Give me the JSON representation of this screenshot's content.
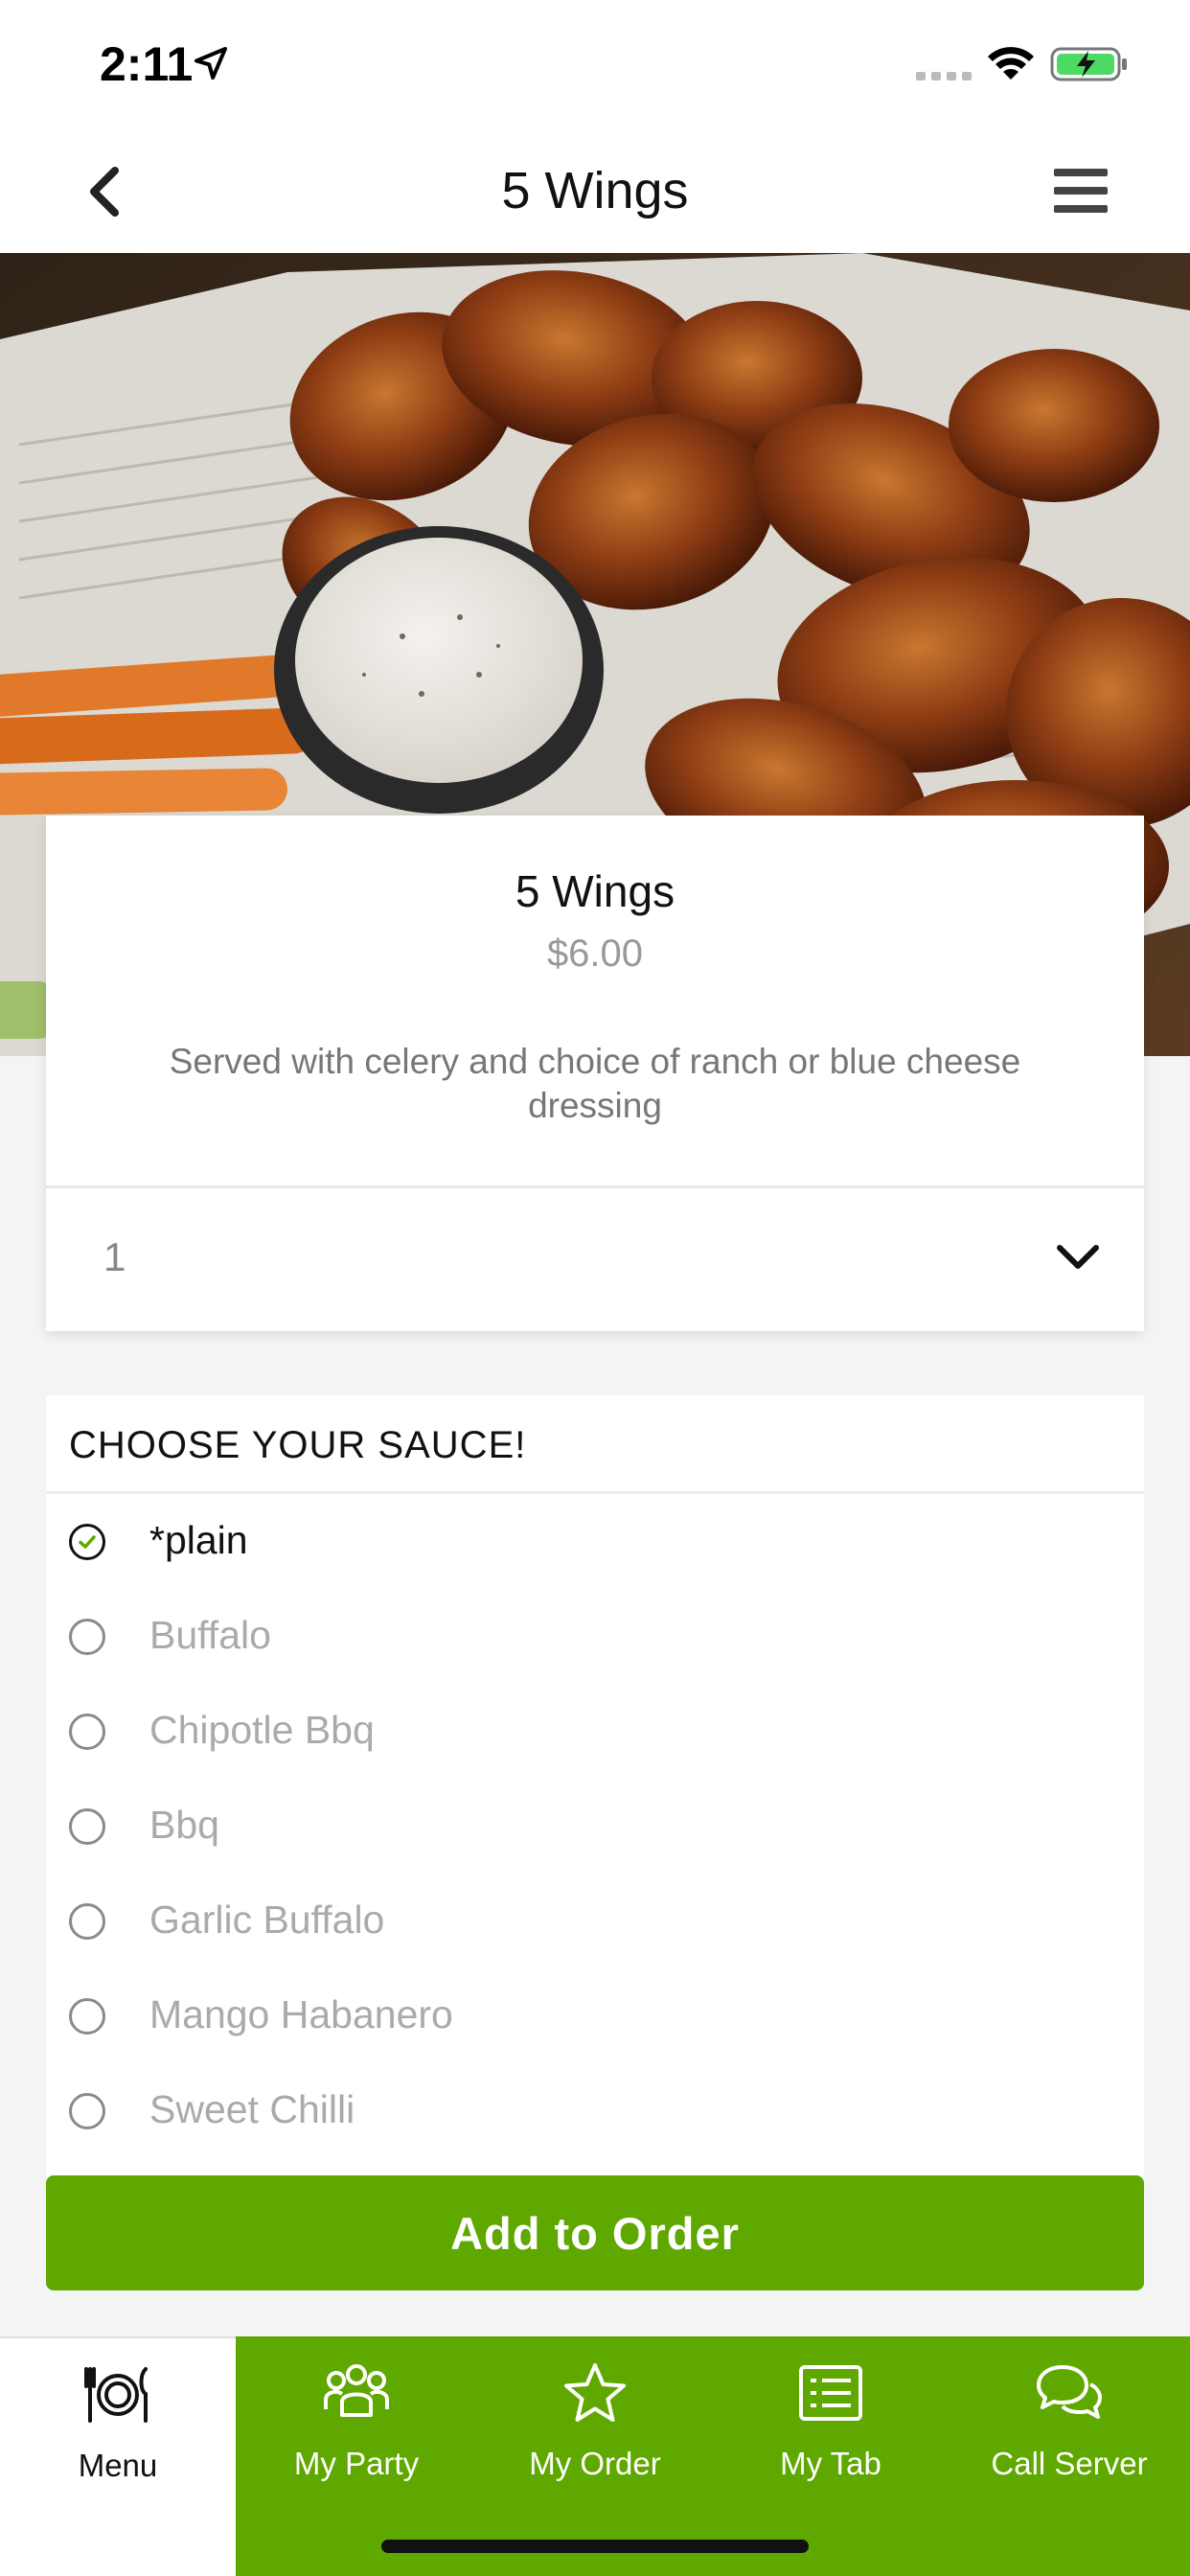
{
  "status_bar": {
    "time": "2:11",
    "icons": [
      "location-arrow-icon",
      "cellular-signal-icon",
      "wifi-icon",
      "battery-charging-icon"
    ]
  },
  "nav": {
    "title": "5 Wings",
    "back_icon": "chevron-left-icon",
    "menu_icon": "hamburger-icon"
  },
  "item": {
    "name": "5 Wings",
    "price": "$6.00",
    "description": "Served with celery and choice of ranch or blue cheese dressing",
    "quantity": "1"
  },
  "sauce": {
    "header": "CHOOSE YOUR SAUCE!",
    "options": [
      {
        "label": "*plain",
        "selected": true
      },
      {
        "label": "Buffalo",
        "selected": false
      },
      {
        "label": "Chipotle Bbq",
        "selected": false
      },
      {
        "label": "Bbq",
        "selected": false
      },
      {
        "label": "Garlic Buffalo",
        "selected": false
      },
      {
        "label": "Mango Habanero",
        "selected": false
      },
      {
        "label": "Sweet Chilli",
        "selected": false
      }
    ]
  },
  "add_button": {
    "label": "Add to Order"
  },
  "tabs": [
    {
      "label": "Menu",
      "icon": "plate-cutlery-icon",
      "active": true
    },
    {
      "label": "My Party",
      "icon": "group-icon",
      "active": false
    },
    {
      "label": "My Order",
      "icon": "star-icon",
      "active": false
    },
    {
      "label": "My Tab",
      "icon": "list-icon",
      "active": false
    },
    {
      "label": "Call Server",
      "icon": "chat-bubbles-icon",
      "active": false
    }
  ],
  "colors": {
    "brand_green": "#5fa800",
    "check_green": "#5fa800",
    "muted_text": "#999999"
  }
}
